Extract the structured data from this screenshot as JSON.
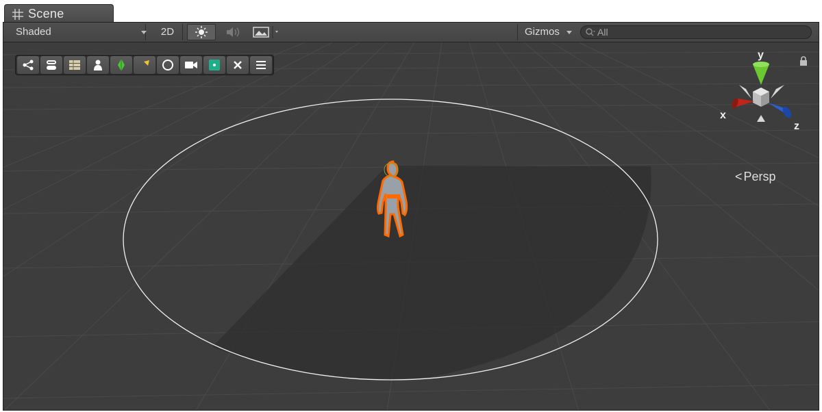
{
  "tab": {
    "title": "Scene"
  },
  "toolbar": {
    "draw_mode": "Shaded",
    "mode_2d": "2D",
    "gizmos": "Gizmos",
    "search_placeholder": "All"
  },
  "tools": [
    {
      "icon": "share-icon"
    },
    {
      "icon": "layers-icon"
    },
    {
      "icon": "list-icon"
    },
    {
      "icon": "person-icon"
    },
    {
      "icon": "diamond-icon"
    },
    {
      "icon": "arrow-icon"
    },
    {
      "icon": "circle-icon"
    },
    {
      "icon": "camera-icon"
    },
    {
      "icon": "square-dot-icon"
    },
    {
      "icon": "close-icon"
    },
    {
      "icon": "menu-icon"
    }
  ],
  "orientation_gizmo": {
    "x_label": "x",
    "y_label": "y",
    "z_label": "z",
    "projection": "Persp",
    "x_color": "#c0251a",
    "y_color": "#6cc830",
    "z_color": "#2a5fd6"
  },
  "selection_color": "#ff6a00",
  "light_ring_color": "#f2f2f2"
}
